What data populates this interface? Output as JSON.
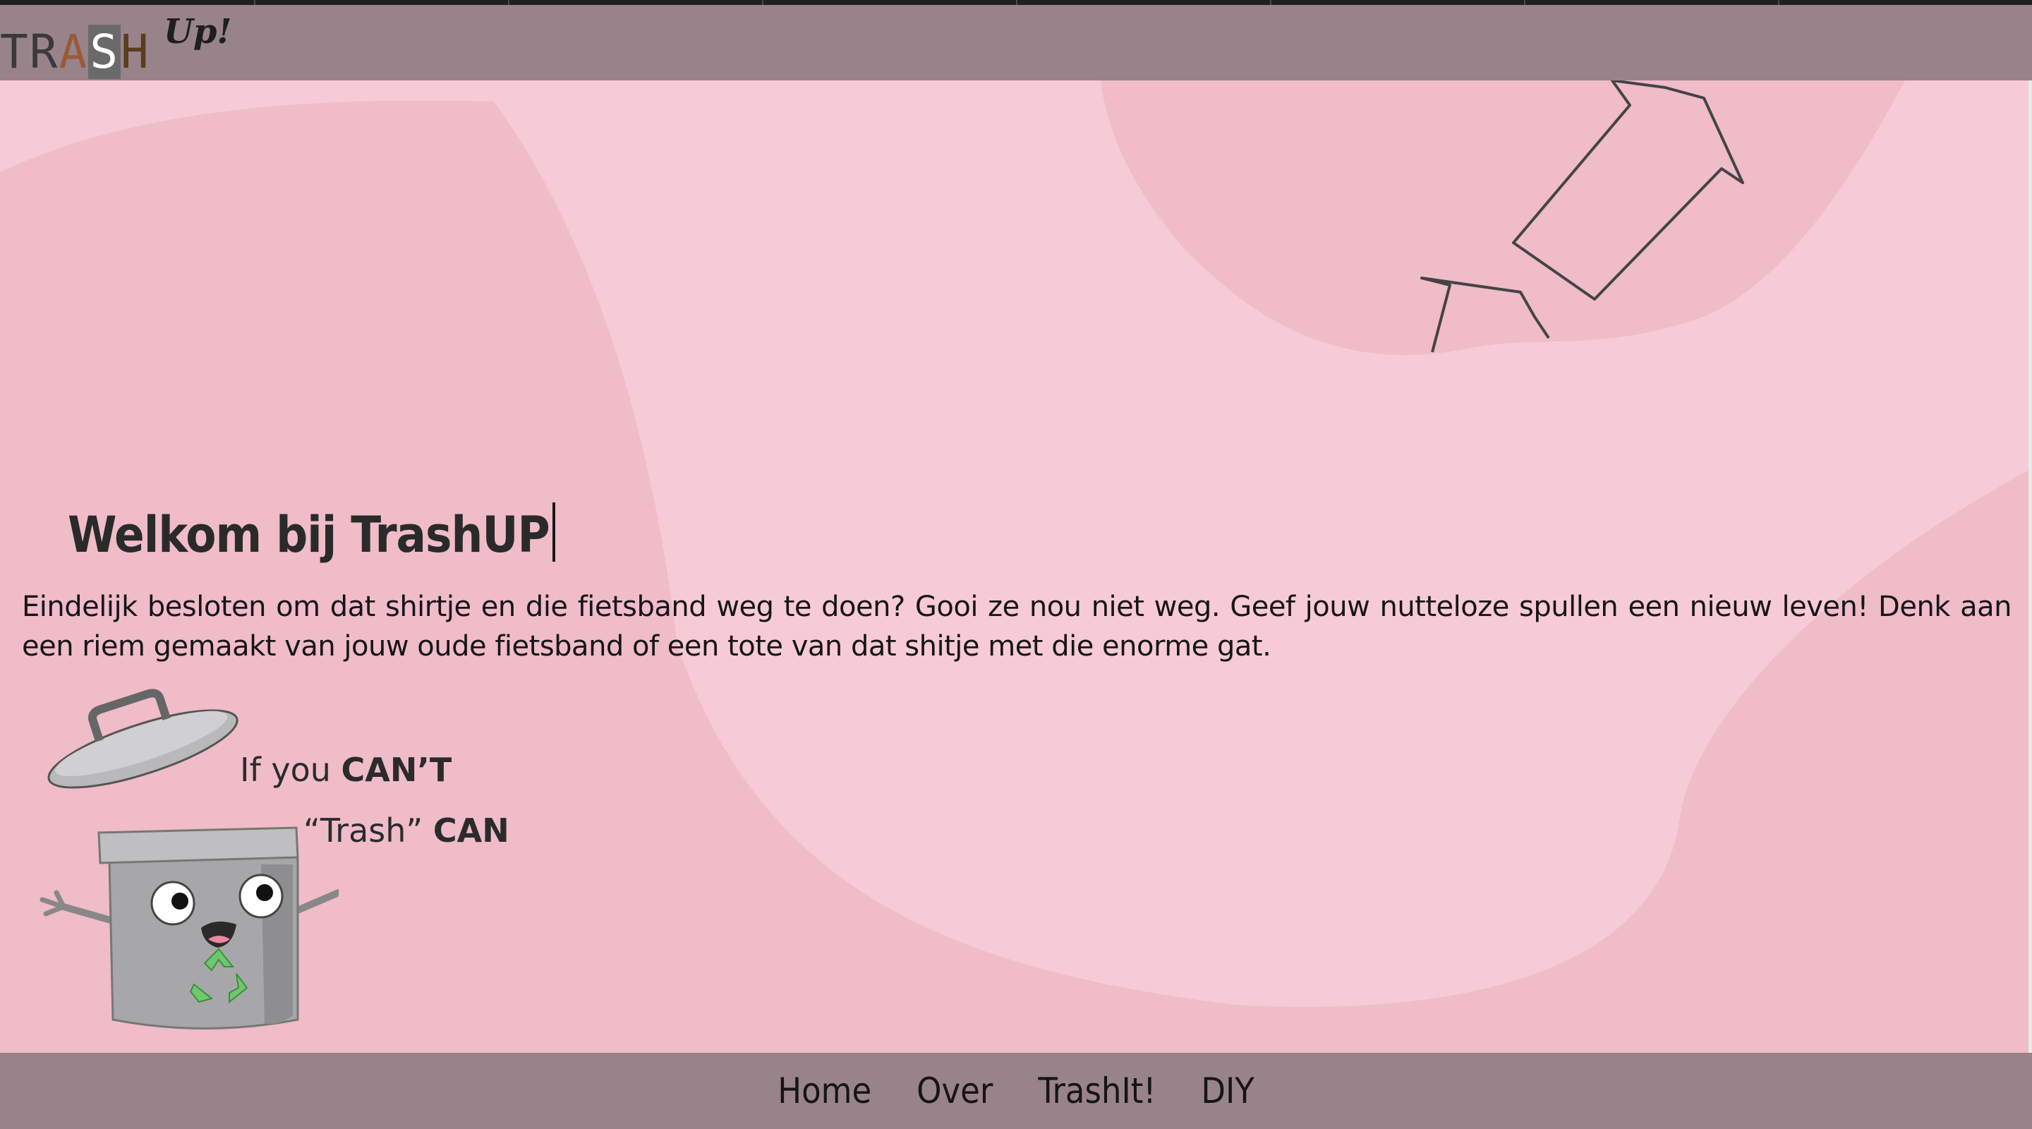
{
  "header": {
    "logo_text": "TRASH",
    "logo_sup": "Up!"
  },
  "main": {
    "welcome_title": "Welkom bij TrashUP",
    "intro_text": "Eindelijk besloten om dat shirtje en die fietsband weg te doen? Gooi ze nou niet weg. Geef jouw nutteloze spullen een nieuw leven! Denk aan een riem gemaakt van jouw oude fietsband of een tote van dat shitje met die enorme gat.",
    "mascot": {
      "line1_pre": "If you ",
      "line1_bold": "CAN’T",
      "line2_pre": "“Trash” ",
      "line2_bold": "CAN"
    }
  },
  "nav": {
    "items": [
      "Home",
      "Over",
      "TrashIt!",
      "DIY"
    ]
  },
  "colors": {
    "header_bg": "#99838b",
    "page_bg": "#f6cbd5",
    "blob": "#efbcc7"
  }
}
